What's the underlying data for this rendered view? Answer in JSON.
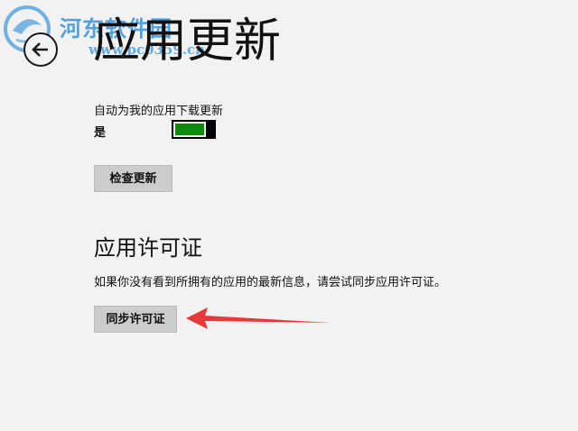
{
  "watermark": {
    "name": "河东软件园",
    "url": "www.pc0359.cn"
  },
  "header": {
    "title": "应用更新"
  },
  "auto_update": {
    "label": "自动为我的应用下载更新",
    "state_label": "是",
    "enabled": true,
    "toggle_color": "#0d8a0d"
  },
  "buttons": {
    "check_updates": "检查更新",
    "sync_licenses": "同步许可证"
  },
  "licenses": {
    "heading": "应用许可证",
    "description": "如果你没有看到所拥有的应用的最新信息，请尝试同步应用许可证。"
  },
  "annotation": {
    "arrow_color": "#e8393a"
  },
  "colors": {
    "background": "#f2f2f2",
    "button": "#cccccc",
    "watermark": "#288cdc"
  }
}
